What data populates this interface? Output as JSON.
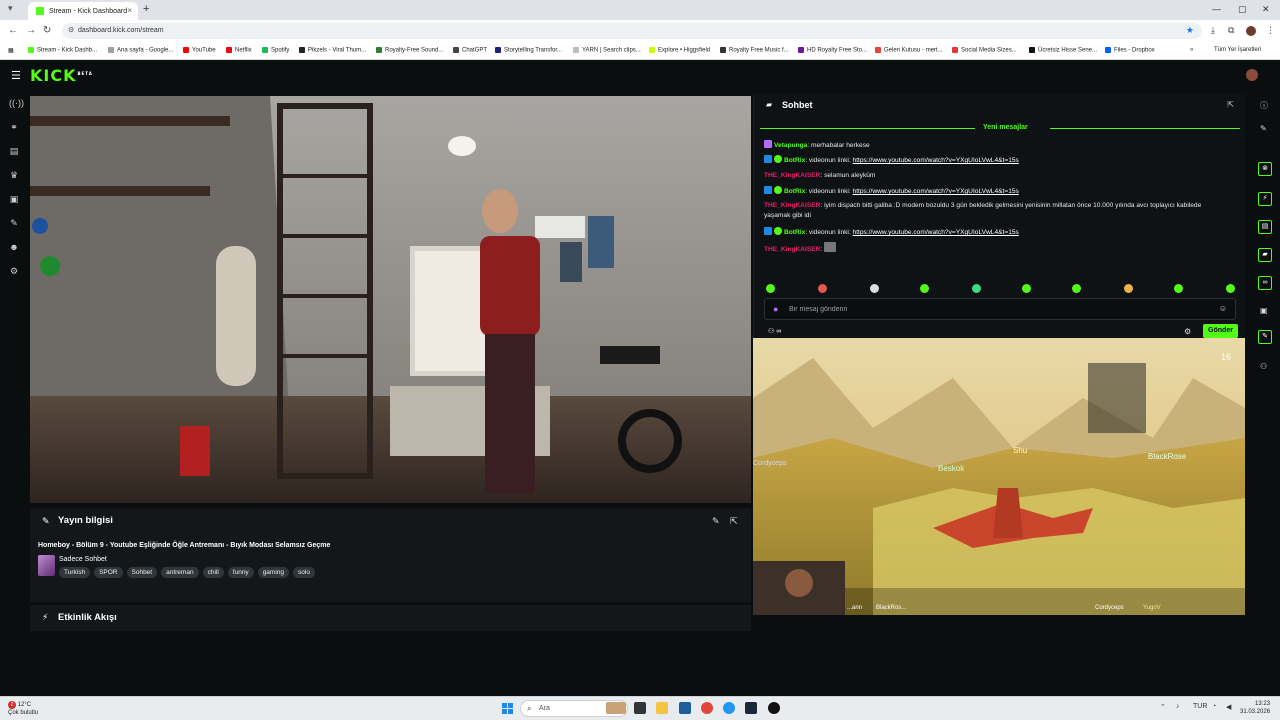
{
  "browser": {
    "tab_title": "Stream - Kick Dashboard",
    "tab_close": "×",
    "new_tab": "+",
    "url": "dashboard.kick.com/stream",
    "window_controls": [
      "—",
      "▢",
      "✕"
    ],
    "bookmarks": [
      {
        "label": "Stream - Kick Dashb...",
        "color": "#53fc18"
      },
      {
        "label": "Ana sayfa - Google...",
        "color": "#a0a0a0"
      },
      {
        "label": "YouTube",
        "color": "#ff0000"
      },
      {
        "label": "Netflix",
        "color": "#e50914"
      },
      {
        "label": "Spotify",
        "color": "#1db954"
      },
      {
        "label": "Pikzels - Viral Thum...",
        "color": "#222222"
      },
      {
        "label": "Royalty-Free Sound...",
        "color": "#2e7d32"
      },
      {
        "label": "ChatGPT",
        "color": "#444444"
      },
      {
        "label": "Storytelling Transfor...",
        "color": "#1a237e"
      },
      {
        "label": "YARN | Search clips...",
        "color": "#e0e0e0"
      },
      {
        "label": "Explore • Higgsfield",
        "color": "#c6ff00"
      },
      {
        "label": "Royalty Free Music f...",
        "color": "#333333"
      },
      {
        "label": "HD Royalty Free Sto...",
        "color": "#6a1b9a"
      },
      {
        "label": "Gelen Kutusu - mert...",
        "color": "#ea4335"
      },
      {
        "label": "Social Media Sizes...",
        "color": "#e53935"
      },
      {
        "label": "Ücretsiz Hisse Sene...",
        "color": "#111111"
      },
      {
        "label": "Files - Dropbox",
        "color": "#0061ff"
      }
    ],
    "all_bookmarks": "Tüm Yer İşaretleri"
  },
  "kick": {
    "logo": "KICK",
    "logo_badge": "BETA",
    "accent": "#53fc18"
  },
  "stream_info": {
    "heading": "Yayın bilgisi",
    "title": "Homeboy - Bölüm 9 - Youtube Eşliğinde Öğle Antremanı - Bıyık Modası Selamsız Geçme",
    "category": "Sadece Sohbet",
    "tags": [
      "Turkish",
      "SPOR",
      "Sohbet",
      "antreman",
      "chill",
      "funny",
      "gaming",
      "solo"
    ]
  },
  "activity": {
    "heading": "Etkinlik Akışı"
  },
  "chat": {
    "heading": "Sohbet",
    "new_messages": "Yeni mesajlar",
    "messages": [
      {
        "user": "Vetapunga",
        "color": "#53fc18",
        "text": "merhabalar herkese",
        "link": ""
      },
      {
        "user": "BotRix",
        "color": "#53fc18",
        "text": "videonun linki: ",
        "link": "https://www.youtube.com/watch?v=YXgUIoLVwL4&t=15s"
      },
      {
        "user": "THE_KingKAISER",
        "color": "#e91e63",
        "text": "selamun aleyküm",
        "link": ""
      },
      {
        "user": "BotRix",
        "color": "#53fc18",
        "text": "videonun linki: ",
        "link": "https://www.youtube.com/watch?v=YXgUIoLVwL4&t=15s"
      },
      {
        "user": "THE_KingKAISER",
        "color": "#e91e63",
        "text": "iyim dispach bitti galiba :D modem bozuldu 3 gün bekledik gelmesini yenisinin millatan önce 10.000 yılında avcı toplayıcı kabilede yaşamak gibi idi",
        "link": ""
      },
      {
        "user": "BotRix",
        "color": "#53fc18",
        "text": "videonun linki: ",
        "link": "https://www.youtube.com/watch?v=YXgUIoLVwL4&t=15s"
      },
      {
        "user": "THE_KingKAISER",
        "color": "#e91e63",
        "text": "",
        "link": ""
      }
    ],
    "input_placeholder": "Bir mesaj gönderin",
    "send_label": "Gönder"
  },
  "game_overlay": {
    "players": [
      "Shu",
      "Beskok",
      "BlackRose",
      "Cordyceps",
      "Yuvar"
    ],
    "score": "16",
    "bottom_names": [
      "...ann",
      "BlackRos...",
      "Cordyceps",
      "YugoV"
    ]
  },
  "taskbar": {
    "weather_temp": "12°C",
    "weather_desc": "Çok bulutlu",
    "alert_count": "2",
    "search_placeholder": "Ara",
    "lang": "TUR",
    "time": "13:23",
    "date": "31.03.2026"
  }
}
